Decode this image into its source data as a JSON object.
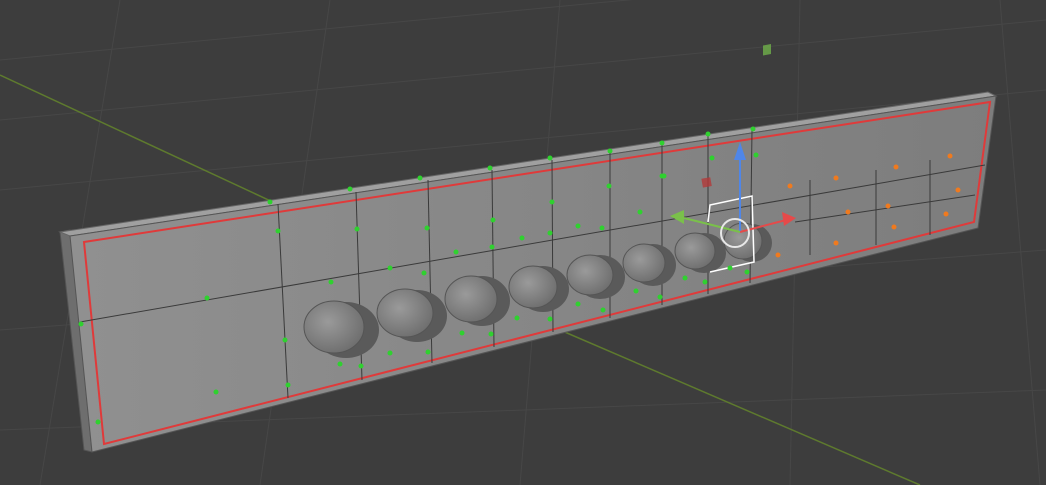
{
  "viewport": {
    "mode": "Edit Mode",
    "background_color": "#3d3d3d",
    "grid_color": "#4a4a4a",
    "x_axis_color": "#5e7a2e",
    "panel_color": "#8a8a8a",
    "selection_outline_color": "#e03a3a",
    "vertex_color_group_a": "#2fd12f",
    "vertex_color_group_b": "#f07a1e",
    "knob_color": "#7e7e7e",
    "knob_count": 8
  },
  "gizmo": {
    "z_axis_color": "#4f86e8",
    "x_axis_color": "#e54a4a",
    "y_axis_color": "#7ac04a",
    "icons": [
      "arrow-up-icon",
      "arrow-right-icon",
      "arrow-left-icon",
      "pivot-circle-icon"
    ]
  }
}
